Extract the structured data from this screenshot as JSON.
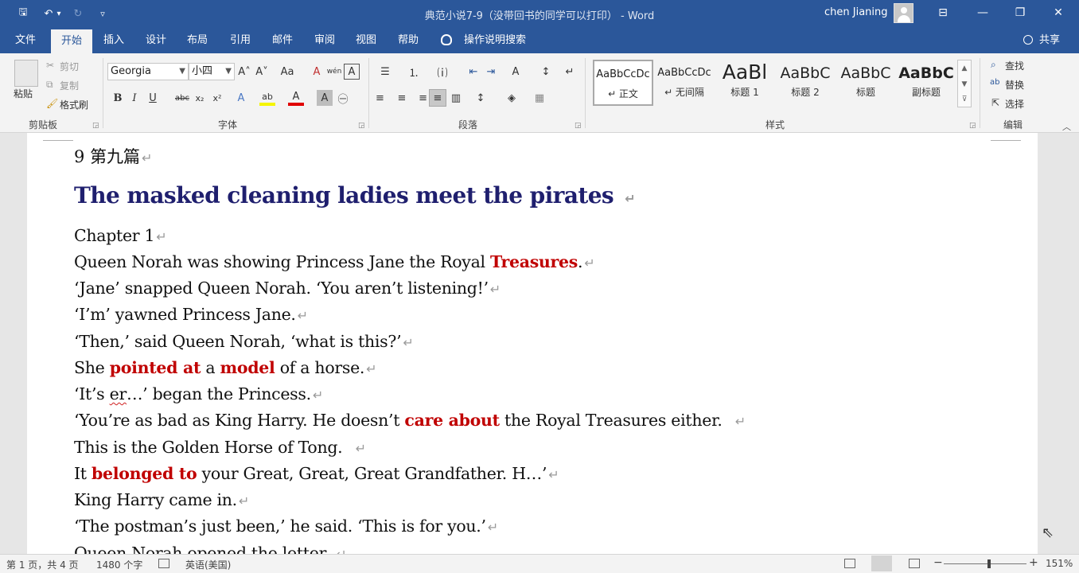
{
  "titlebar": {
    "document_title": "典范小说7-9（没带回书的同学可以打印） - Word",
    "user_name": "chen Jianing",
    "qat": {
      "save": "🖫",
      "undo": "↶",
      "undo_drop": "▾",
      "redo": "↻",
      "customize": "▿"
    },
    "window": {
      "ribbon_options": "⊟",
      "minimize": "—",
      "restore": "❐",
      "close": "✕"
    }
  },
  "tabs": [
    "文件",
    "开始",
    "插入",
    "设计",
    "布局",
    "引用",
    "邮件",
    "审阅",
    "视图",
    "帮助"
  ],
  "active_tab": "开始",
  "tell_me": "操作说明搜索",
  "share": "共享",
  "ribbon": {
    "clipboard": {
      "paste": "粘贴",
      "cut": "剪切",
      "copy": "复制",
      "format_painter": "格式刷",
      "label": "剪贴板"
    },
    "font": {
      "font_name": "Georgia",
      "font_size": "小四",
      "label": "字体",
      "grow": "A˄",
      "shrink": "A˅",
      "change_case": "Aa",
      "clear": "A",
      "phonetic": "wén",
      "border_char": "A",
      "bold": "B",
      "italic": "I",
      "underline": "U",
      "strike": "abc",
      "subscript": "x₂",
      "superscript": "x²",
      "text_effects": "A",
      "highlight": "ab",
      "font_color": "A",
      "char_shading": "A",
      "enclose": "㊀"
    },
    "paragraph": {
      "label": "段落",
      "bullets": "☰",
      "numbering": "⒈",
      "multilevel": "⒤",
      "decrease_indent": "⇤",
      "increase_indent": "⇥",
      "chinese_layout": "A",
      "sort": "↕",
      "show_marks": "↵",
      "align_left": "≡",
      "center": "≡",
      "align_right": "≡",
      "justify": "≡",
      "distributed": "▥",
      "line_spacing": "↕",
      "shading": "◈",
      "borders": "▦"
    },
    "styles": {
      "label": "样式",
      "items": [
        {
          "preview": "AaBbCcDc",
          "name": "↵ 正文",
          "selected": true
        },
        {
          "preview": "AaBbCcDc",
          "name": "↵ 无间隔",
          "selected": false
        },
        {
          "preview": "AaBl",
          "name": "标题 1",
          "selected": false
        },
        {
          "preview": "AaBbC",
          "name": "标题 2",
          "selected": false
        },
        {
          "preview": "AaBbC",
          "name": "标题",
          "selected": false
        },
        {
          "preview": "AaBbC",
          "name": "副标题",
          "selected": false
        }
      ]
    },
    "editing": {
      "label": "编辑",
      "find": "查找",
      "replace": "替换",
      "select": "选择"
    }
  },
  "document": {
    "section_heading": "9  第九篇",
    "title": "The masked cleaning ladies meet the pirates",
    "chapter": "Chapter 1",
    "para_mark": "↵",
    "lines": {
      "l1a": "Queen Norah was showing Princess Jane the Royal ",
      "l1b": "Treasures",
      "l1c": ".",
      "l2": "‘Jane’ snapped Queen Norah. ‘You aren’t listening!’",
      "l3": "‘I’m’ yawned Princess Jane.",
      "l4": "‘Then,’ said Queen Norah, ‘what is this?’",
      "l5a": "She ",
      "l5b": "pointed at",
      "l5c": " a ",
      "l5d": "model",
      "l5e": " of a horse.",
      "l6a": "‘It’s ",
      "l6b": "er",
      "l6c": "…’ began the Princess.",
      "l7a": "‘You’re as bad as King Harry. He doesn’t ",
      "l7b": "care about",
      "l7c": " the Royal Treasures either.  ",
      "l8": "This is the Golden Horse of Tong.  ",
      "l9a": "It ",
      "l9b": "belonged to",
      "l9c": " your Great, Great, Great Grandfather. H…’",
      "l10": "King Harry came in.",
      "l11": "‘The postman’s just been,’ he said. ‘This is for you.’",
      "l12": "Queen Norah opened the letter. "
    }
  },
  "status": {
    "page": "第 1 页，共 4 页",
    "words": "1480 个字",
    "language": "英语(美国)",
    "zoom_minus": "−",
    "zoom_plus": "+",
    "zoom": "151%",
    "zoom_level_percent": 151
  },
  "colors": {
    "accent": "#2b579a",
    "heading": "#1f1f6e",
    "highlight": "#c00000"
  }
}
